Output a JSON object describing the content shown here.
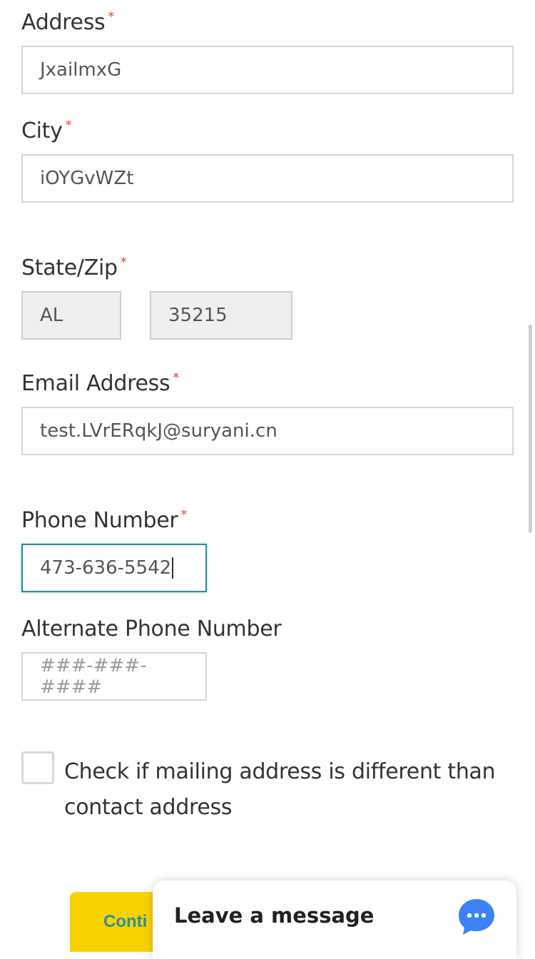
{
  "form": {
    "required_mark": "*",
    "address": {
      "label": "Address",
      "value": "JxailmxG"
    },
    "city": {
      "label": "City",
      "value": "iOYGvWZt"
    },
    "state_zip": {
      "label": "State/Zip",
      "state": "AL",
      "zip": "35215"
    },
    "email": {
      "label": "Email Address",
      "value": "test.LVrERqkJ@suryani.cn"
    },
    "phone": {
      "label": "Phone Number",
      "value": "473-636-5542"
    },
    "alt_phone": {
      "label": "Alternate Phone Number",
      "placeholder": "###-###-####",
      "value": ""
    },
    "mailing_checkbox": {
      "label": "Check if mailing address is different than contact address",
      "checked": false
    },
    "continue_label": "Conti"
  },
  "chat": {
    "label": "Leave a message",
    "icon": "chat-bubble-icon",
    "color": "#3b82f6"
  },
  "colors": {
    "accent": "#2a8f9c",
    "button": "#f9d200",
    "required": "#e2463b"
  }
}
